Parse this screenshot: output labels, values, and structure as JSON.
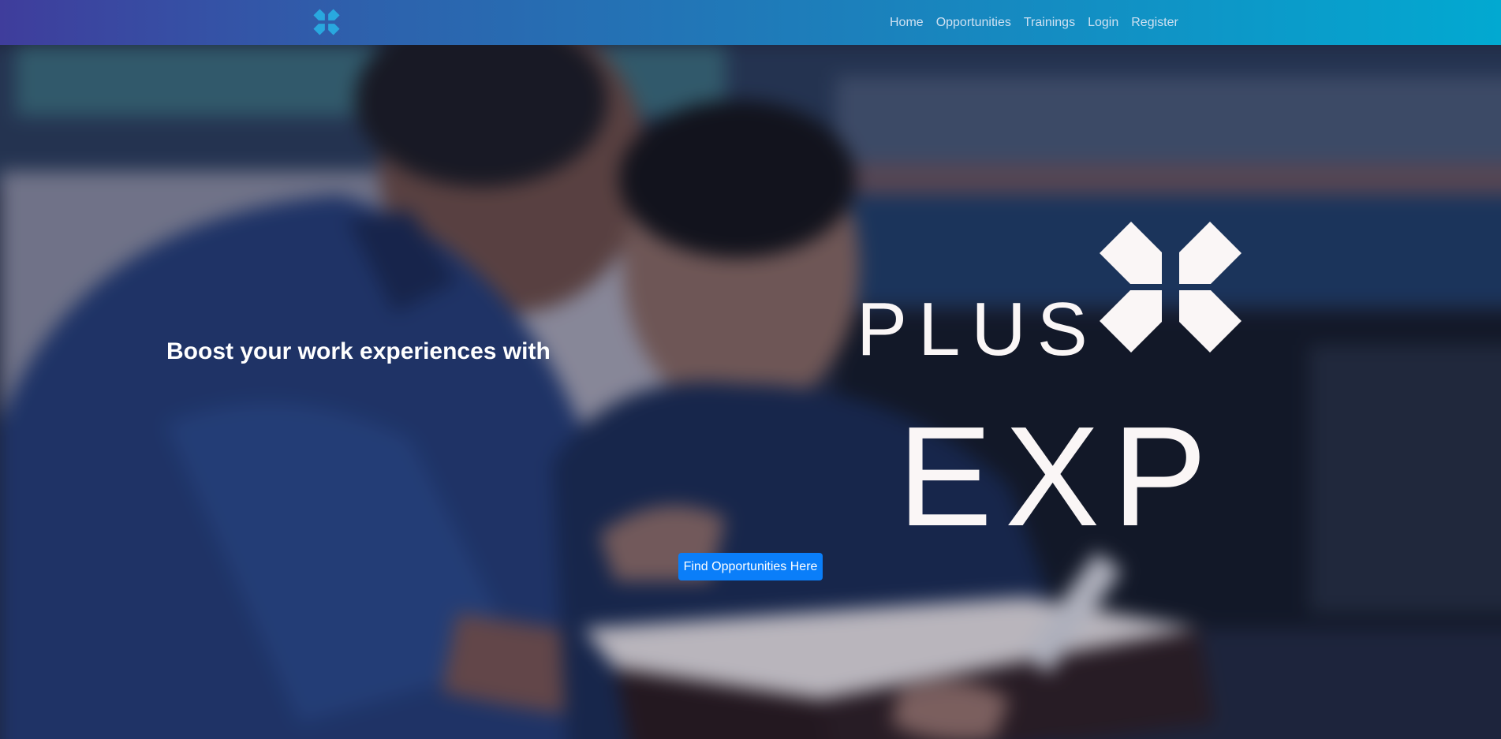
{
  "navbar": {
    "logo_icon": "plus-exp-x-icon",
    "links": [
      {
        "label": "Home"
      },
      {
        "label": "Opportunities"
      },
      {
        "label": "Trainings"
      },
      {
        "label": "Login"
      },
      {
        "label": "Register"
      }
    ]
  },
  "hero": {
    "tagline": "Boost your work experiences with",
    "brand_line_1": "PLUS",
    "brand_line_2": "EXP",
    "cta_label": "Find Opportunities Here",
    "background_image": "blurred-photo-two-men-reading-book"
  },
  "colors": {
    "nav_gradient_start": "#3f3d9c",
    "nav_gradient_end": "#02a9d1",
    "logo_cyan": "#29a8df",
    "cta_blue": "#0a7ef9",
    "brand_white": "#faf6f6"
  }
}
